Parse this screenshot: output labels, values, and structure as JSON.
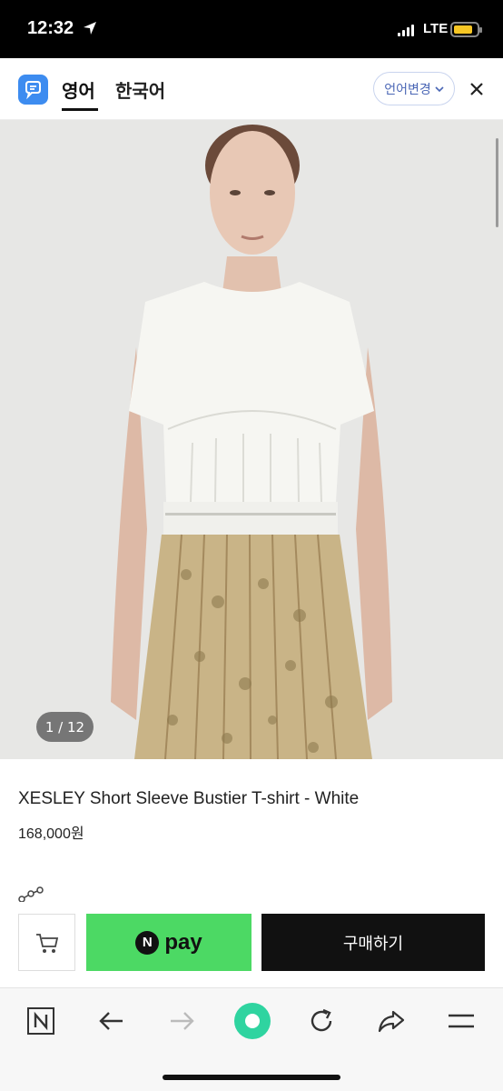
{
  "status_bar": {
    "time": "12:32",
    "network": "LTE",
    "battery_color": "#f6c624",
    "battery_level": 0.85,
    "icons": [
      "location-arrow-icon",
      "signal-icon",
      "battery-icon"
    ]
  },
  "header": {
    "tabs": [
      {
        "label": "영어",
        "active": true
      },
      {
        "label": "한국어",
        "active": false
      }
    ],
    "language_button": "언어변경",
    "icons": [
      "app-logo-icon",
      "chevron-down-icon",
      "close-icon"
    ]
  },
  "gallery": {
    "counter": "1 / 12"
  },
  "product": {
    "name": "XESLEY Short Sleeve Bustier T-shirt - White",
    "price": "168,000원"
  },
  "purchase_bar": {
    "npay_mark": "N",
    "npay_label": "pay",
    "buy_label": "구매하기",
    "npay_color": "#4cd964",
    "icons": [
      "cart-icon"
    ]
  },
  "toolbar": {
    "icons": [
      "naver-n-icon",
      "back-arrow-icon",
      "forward-arrow-icon",
      "green-dot-icon",
      "reload-icon",
      "share-icon",
      "menu-icon"
    ],
    "accent": "#2fd4a0"
  }
}
